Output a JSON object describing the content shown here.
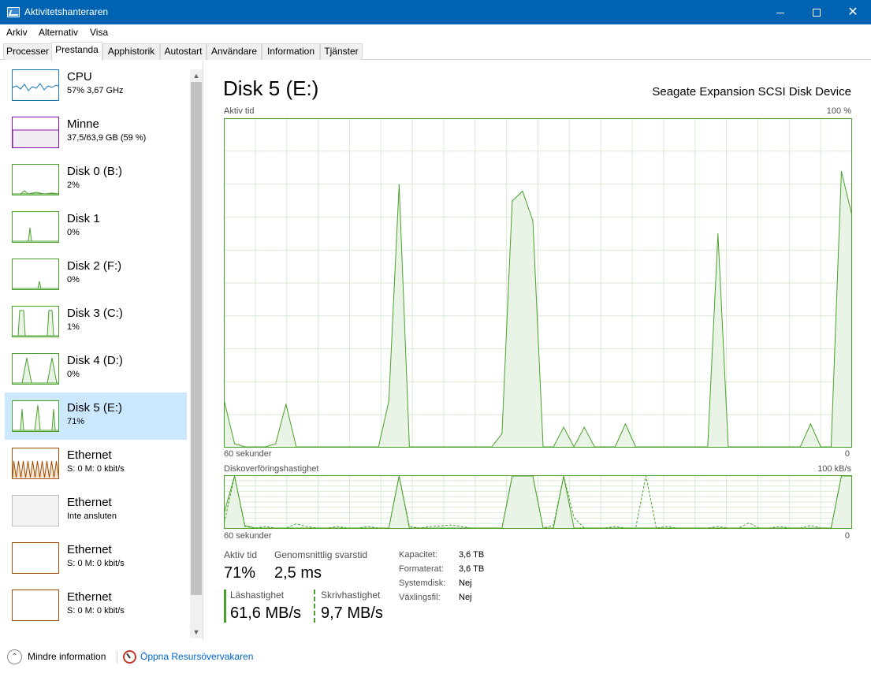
{
  "window": {
    "title": "Aktivitetshanteraren",
    "icon": "task-manager-icon"
  },
  "menu": [
    "Arkiv",
    "Alternativ",
    "Visa"
  ],
  "tabs": [
    "Processer",
    "Prestanda",
    "Apphistorik",
    "Autostart",
    "Användare",
    "Information",
    "Tjänster"
  ],
  "active_tab": "Prestanda",
  "resources": [
    {
      "name": "CPU",
      "sub": "57% 3,67 GHz",
      "color": "#1779ba"
    },
    {
      "name": "Minne",
      "sub": "37,5/63,9 GB (59 %)",
      "color": "#8b12ae"
    },
    {
      "name": "Disk 0 (B:)",
      "sub": "2%",
      "color": "#4aa02c"
    },
    {
      "name": "Disk 1",
      "sub": "0%",
      "color": "#4aa02c"
    },
    {
      "name": "Disk 2 (F:)",
      "sub": "0%",
      "color": "#4aa02c"
    },
    {
      "name": "Disk 3 (C:)",
      "sub": "1%",
      "color": "#4aa02c"
    },
    {
      "name": "Disk 4 (D:)",
      "sub": "0%",
      "color": "#4aa02c"
    },
    {
      "name": "Disk 5 (E:)",
      "sub": "71%",
      "color": "#4aa02c",
      "selected": true
    },
    {
      "name": "Ethernet",
      "sub": "S: 0 M: 0 kbit/s",
      "color": "#a74f01"
    },
    {
      "name": "Ethernet",
      "sub": "Inte ansluten",
      "color": "#bdbdbd"
    },
    {
      "name": "Ethernet",
      "sub": "S: 0 M: 0 kbit/s",
      "color": "#a74f01"
    },
    {
      "name": "Ethernet",
      "sub": "S: 0 M: 0 kbit/s",
      "color": "#a74f01"
    }
  ],
  "detail": {
    "title": "Disk 5 (E:)",
    "model": "Seagate Expansion SCSI Disk Device",
    "chart1_label": "Aktiv tid",
    "chart1_max": "100 %",
    "chart1_time": "60 sekunder",
    "chart1_min": "0",
    "chart2_label": "Diskoverföringshastighet",
    "chart2_max": "100 kB/s",
    "chart2_time": "60 sekunder",
    "chart2_min": "0",
    "active_time_label": "Aktiv tid",
    "active_time_value": "71%",
    "response_label": "Genomsnittlig svarstid",
    "response_value": "2,5 ms",
    "read_label": "Läshastighet",
    "read_value": "61,6 MB/s",
    "write_label": "Skrivhastighet",
    "write_value": "9,7 MB/s",
    "props": [
      {
        "label": "Kapacitet:",
        "value": "3,6 TB"
      },
      {
        "label": "Formaterat:",
        "value": "3,6 TB"
      },
      {
        "label": "Systemdisk:",
        "value": "Nej"
      },
      {
        "label": "Växlingsfil:",
        "value": "Nej"
      }
    ]
  },
  "footer": {
    "less_info": "Mindre information",
    "open_monitor": "Öppna Resursövervakaren"
  },
  "colors": {
    "titlebar": "#0063b1",
    "disk_green": "#4aa02c",
    "selected": "#cce8ff"
  },
  "chart_data": [
    {
      "type": "area",
      "title": "Aktiv tid",
      "ylabel": "%",
      "ylim": [
        0,
        100
      ],
      "x": [
        0,
        1,
        2,
        3,
        4,
        5,
        6,
        7,
        8,
        9,
        10,
        11,
        12,
        13,
        14,
        15,
        16,
        17,
        18,
        19,
        20,
        21,
        22,
        23,
        24,
        25,
        26,
        27,
        28,
        29,
        30,
        31,
        32,
        33,
        34,
        35,
        36,
        37,
        38,
        39,
        40,
        41,
        42,
        43,
        44,
        45,
        46,
        47,
        48,
        49,
        50,
        51,
        52,
        53,
        54,
        55,
        56,
        57,
        58,
        59,
        60
      ],
      "values": [
        14,
        1,
        0,
        0,
        0,
        1,
        13,
        0,
        0,
        0,
        0,
        0,
        0,
        0,
        0,
        0,
        14,
        80,
        0,
        0,
        0,
        0,
        0,
        0,
        0,
        0,
        0,
        4,
        75,
        78,
        69,
        0,
        0,
        6,
        0,
        6,
        0,
        0,
        0,
        7,
        0,
        0,
        0,
        0,
        0,
        0,
        0,
        0,
        65,
        0,
        0,
        0,
        0,
        0,
        0,
        0,
        0,
        7,
        0,
        0,
        84,
        71
      ]
    },
    {
      "type": "line",
      "title": "Diskoverföringshastighet",
      "ylabel": "kB/s",
      "ylim": [
        0,
        100
      ],
      "series": [
        {
          "name": "Läshastighet",
          "values": [
            30,
            100,
            5,
            0,
            0,
            0,
            0,
            0,
            0,
            0,
            0,
            0,
            0,
            0,
            0,
            0,
            0,
            100,
            0,
            0,
            0,
            0,
            0,
            0,
            0,
            0,
            0,
            0,
            100,
            100,
            100,
            0,
            0,
            100,
            0,
            0,
            0,
            0,
            0,
            0,
            0,
            0,
            0,
            0,
            0,
            0,
            0,
            0,
            0,
            0,
            0,
            0,
            0,
            0,
            0,
            0,
            0,
            0,
            0,
            0,
            100,
            100
          ]
        },
        {
          "name": "Skrivhastighet",
          "values": [
            10,
            100,
            3,
            0,
            3,
            0,
            0,
            8,
            3,
            0,
            0,
            3,
            0,
            0,
            3,
            0,
            0,
            100,
            3,
            0,
            3,
            4,
            6,
            3,
            0,
            0,
            0,
            0,
            100,
            100,
            100,
            0,
            5,
            100,
            20,
            0,
            0,
            0,
            3,
            0,
            0,
            100,
            0,
            3,
            0,
            0,
            0,
            0,
            3,
            0,
            0,
            10,
            0,
            0,
            3,
            0,
            0,
            5,
            0,
            0,
            100,
            100
          ]
        }
      ]
    }
  ]
}
